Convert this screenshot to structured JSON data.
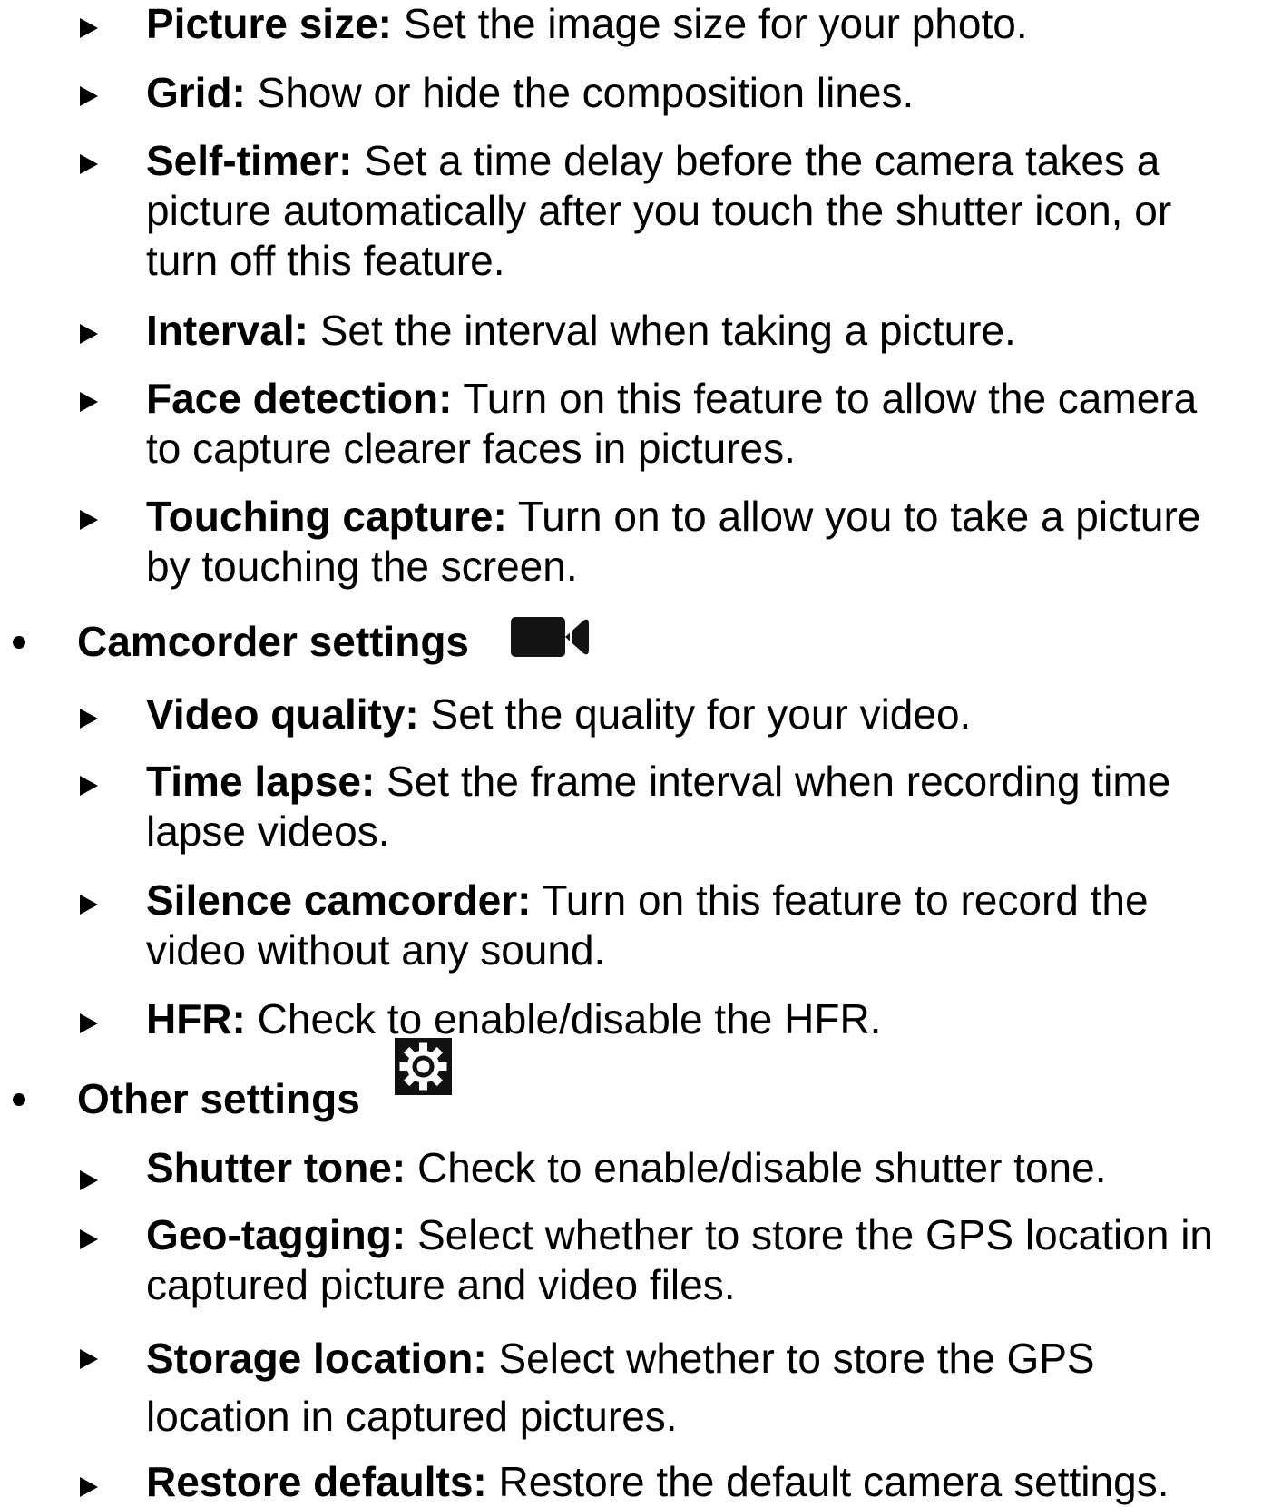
{
  "picture_settings_items": [
    {
      "term": "Picture size:",
      "desc": " Set the image size for your photo.",
      "lines": [
        "Set the image size for your photo."
      ]
    },
    {
      "term": "Grid:",
      "desc": " Show or hide the composition lines."
    },
    {
      "term": "Self-timer:",
      "line1": " Set a time delay before the camera takes a",
      "line2": "picture automatically after you touch the shutter icon, or",
      "line3": "turn off this feature."
    },
    {
      "term": "Interval:",
      "desc": " Set the interval when taking a picture."
    },
    {
      "term": "Face detection:",
      "line1": " Turn on this feature to allow the camera",
      "line2": "to capture clearer faces in pictures."
    },
    {
      "term": "Touching capture:",
      "line1": " Turn on to allow you to take a picture",
      "line2": "by touching the screen."
    }
  ],
  "camcorder_section": {
    "label": "Camcorder settings",
    "icon": "video-camera-icon",
    "items": [
      {
        "term": "Video quality:",
        "desc": " Set the quality for your video."
      },
      {
        "term": "Time lapse:",
        "line1": " Set the frame interval when recording time",
        "line2": "lapse videos."
      },
      {
        "term": "Silence camcorder:",
        "line1": " Turn on this feature to record the",
        "line2": "video without any sound."
      },
      {
        "term": "HFR:",
        "desc": " Check to enable/disable the HFR."
      }
    ]
  },
  "other_section": {
    "label": "Other settings",
    "icon": "gear-icon",
    "items": [
      {
        "term": "Shutter tone:",
        "desc": " Check to enable/disable shutter tone."
      },
      {
        "term": "Geo-tagging:",
        "line1": " Select whether to store the GPS location in",
        "line2": "captured picture and video files."
      },
      {
        "term": "Storage location:",
        "line1": " Select whether to store the GPS",
        "line2": "location in captured pictures."
      },
      {
        "term": "Restore defaults:",
        "desc": " Restore the default camera settings."
      }
    ]
  }
}
